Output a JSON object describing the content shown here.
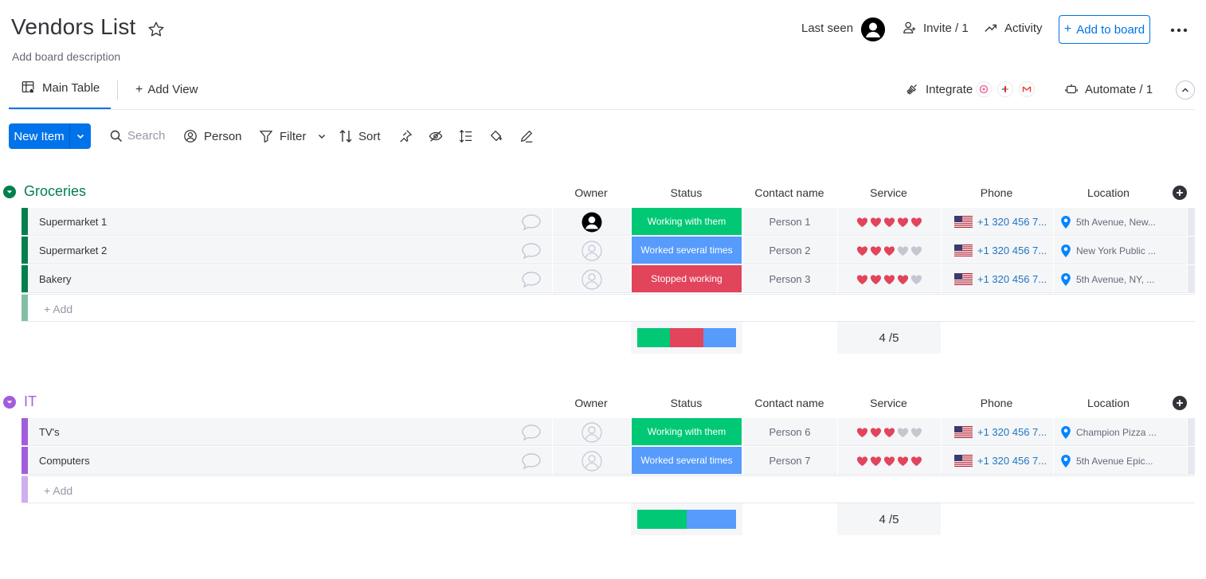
{
  "header": {
    "title": "Vendors List",
    "description": "Add board description",
    "last_seen_label": "Last seen",
    "invite_label": "Invite / 1",
    "activity_label": "Activity",
    "add_to_board_label": "Add to board"
  },
  "views": {
    "main_tab_label": "Main Table",
    "add_view_label": "Add View",
    "integrate_label": "Integrate",
    "automate_label": "Automate / 1"
  },
  "toolbar": {
    "new_item_label": "New Item",
    "search_placeholder": "Search",
    "person_label": "Person",
    "filter_label": "Filter",
    "sort_label": "Sort"
  },
  "columns": {
    "owner": "Owner",
    "status": "Status",
    "contact": "Contact name",
    "service": "Service",
    "phone": "Phone",
    "location": "Location"
  },
  "groups": [
    {
      "title": "Groceries",
      "color": "#037f4c",
      "add_label": "+ Add",
      "summary_rating": "4 /5",
      "summary_status_colors": [
        "#00c875",
        "#e2445c",
        "#579bfc"
      ],
      "items": [
        {
          "name": "Supermarket 1",
          "owner_filled": true,
          "status": "Working with them",
          "status_color": "#00c875",
          "contact": "Person 1",
          "rating": 5,
          "phone": "+1 320 456 7...",
          "location": "5th Avenue, New..."
        },
        {
          "name": "Supermarket 2",
          "owner_filled": false,
          "status": "Worked several times",
          "status_color": "#579bfc",
          "contact": "Person 2",
          "rating": 3,
          "phone": "+1 320 456 7...",
          "location": "New York Public ..."
        },
        {
          "name": "Bakery",
          "owner_filled": false,
          "status": "Stopped working",
          "status_color": "#e2445c",
          "contact": "Person 3",
          "rating": 4,
          "phone": "+1 320 456 7...",
          "location": "5th Avenue, NY, ..."
        }
      ]
    },
    {
      "title": "IT",
      "color": "#a25ddc",
      "add_label": "+ Add",
      "summary_rating": "4 /5",
      "summary_status_colors": [
        "#00c875",
        "#579bfc"
      ],
      "items": [
        {
          "name": "TV's",
          "owner_filled": false,
          "status": "Working with them",
          "status_color": "#00c875",
          "contact": "Person 6",
          "rating": 3,
          "phone": "+1 320 456 7...",
          "location": "Champion Pizza ..."
        },
        {
          "name": "Computers",
          "owner_filled": false,
          "status": "Worked several times",
          "status_color": "#579bfc",
          "contact": "Person 7",
          "rating": 5,
          "phone": "+1 320 456 7...",
          "location": "5th Avenue Epic..."
        }
      ]
    }
  ]
}
